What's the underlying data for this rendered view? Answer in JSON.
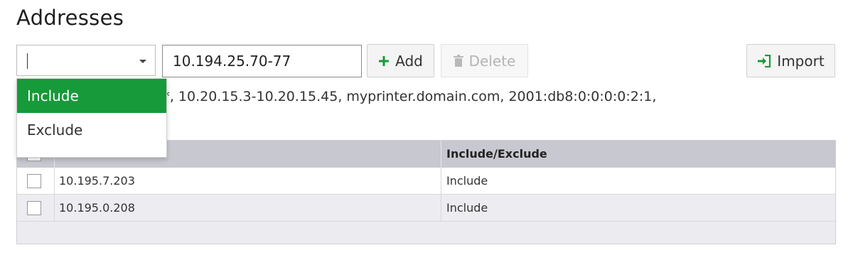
{
  "page": {
    "title": "Addresses"
  },
  "toolbar": {
    "type_select_value": "",
    "address_input_value": "10.194.25.70-77",
    "add_label": "Add",
    "delete_label": "Delete",
    "import_label": "Import"
  },
  "help_text": "7, 10.20.15.*,10.20.*.*, 10.20.15.3-10.20.15.45, myprinter.domain.com, 2001:db8:0:0:0:0:2:1,",
  "dropdown": {
    "options": [
      "Include",
      "Exclude"
    ],
    "selected_index": 0
  },
  "table": {
    "columns": [
      "",
      "Include/Exclude"
    ],
    "rows": [
      {
        "address": "10.195.7.203",
        "mode": "Include"
      },
      {
        "address": "10.195.0.208",
        "mode": "Include"
      }
    ]
  },
  "colors": {
    "accent": "#179a3a",
    "header_bg": "#c8c8d0"
  }
}
